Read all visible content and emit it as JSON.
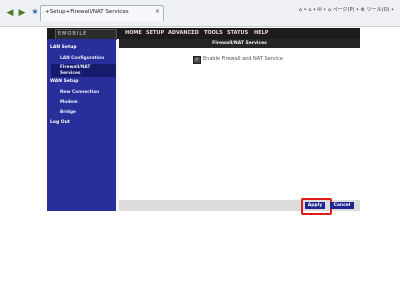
{
  "browser": {
    "tab_title": "+Setup+Firewall/NAT Services",
    "tab_close_glyph": "×",
    "back_glyph": "◀",
    "forward_glyph": "▶",
    "favicon_glyph": "★",
    "right_commands": "⌂ • ⌂ • ✉ • ⌂ ページ(P) • ⚙ ツール(O) •"
  },
  "router": {
    "logo_text": "EMOBILE",
    "nav": [
      "HOME",
      "SETUP",
      "ADVANCED",
      "TOOLS",
      "STATUS",
      "HELP"
    ],
    "sidebar": {
      "lan_setup": "LAN Setup",
      "lan_configuration": "LAN Configuration",
      "firewall_nat_line1": "Firewall/NAT",
      "firewall_nat_line2": "Services",
      "wan_setup": "WAN Setup",
      "new_connection": "New Connection",
      "modem": "Modem",
      "bridge": "Bridge",
      "log_out": "Log Out"
    },
    "content": {
      "title": "Firewall/NAT Services",
      "checkbox_label": "Enable Firewall and NAT Service",
      "checkbox_checked": true,
      "checkbox_glyph": "✓"
    },
    "buttons": {
      "apply": "Apply",
      "cancel": "Cancel"
    },
    "colors": {
      "sidebar": "#282f9a",
      "nav_bar": "#1c1c1c",
      "button": "#1e2590",
      "highlight": "#e11a1a"
    }
  }
}
